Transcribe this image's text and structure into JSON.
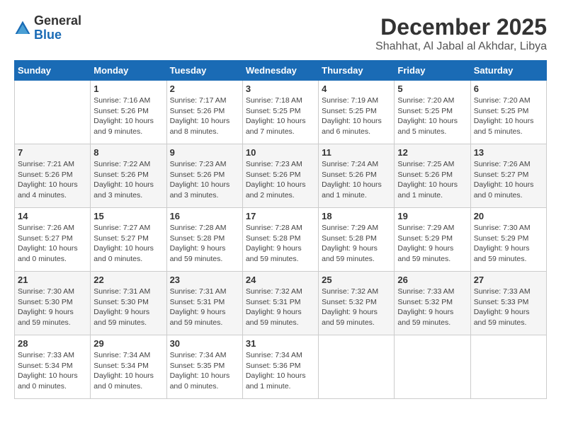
{
  "header": {
    "logo_general": "General",
    "logo_blue": "Blue",
    "month_year": "December 2025",
    "location": "Shahhat, Al Jabal al Akhdar, Libya"
  },
  "days_of_week": [
    "Sunday",
    "Monday",
    "Tuesday",
    "Wednesday",
    "Thursday",
    "Friday",
    "Saturday"
  ],
  "weeks": [
    [
      {
        "day": "",
        "content": ""
      },
      {
        "day": "1",
        "content": "Sunrise: 7:16 AM\nSunset: 5:26 PM\nDaylight: 10 hours and 9 minutes."
      },
      {
        "day": "2",
        "content": "Sunrise: 7:17 AM\nSunset: 5:26 PM\nDaylight: 10 hours and 8 minutes."
      },
      {
        "day": "3",
        "content": "Sunrise: 7:18 AM\nSunset: 5:25 PM\nDaylight: 10 hours and 7 minutes."
      },
      {
        "day": "4",
        "content": "Sunrise: 7:19 AM\nSunset: 5:25 PM\nDaylight: 10 hours and 6 minutes."
      },
      {
        "day": "5",
        "content": "Sunrise: 7:20 AM\nSunset: 5:25 PM\nDaylight: 10 hours and 5 minutes."
      },
      {
        "day": "6",
        "content": "Sunrise: 7:20 AM\nSunset: 5:25 PM\nDaylight: 10 hours and 5 minutes."
      }
    ],
    [
      {
        "day": "7",
        "content": "Sunrise: 7:21 AM\nSunset: 5:26 PM\nDaylight: 10 hours and 4 minutes."
      },
      {
        "day": "8",
        "content": "Sunrise: 7:22 AM\nSunset: 5:26 PM\nDaylight: 10 hours and 3 minutes."
      },
      {
        "day": "9",
        "content": "Sunrise: 7:23 AM\nSunset: 5:26 PM\nDaylight: 10 hours and 3 minutes."
      },
      {
        "day": "10",
        "content": "Sunrise: 7:23 AM\nSunset: 5:26 PM\nDaylight: 10 hours and 2 minutes."
      },
      {
        "day": "11",
        "content": "Sunrise: 7:24 AM\nSunset: 5:26 PM\nDaylight: 10 hours and 1 minute."
      },
      {
        "day": "12",
        "content": "Sunrise: 7:25 AM\nSunset: 5:26 PM\nDaylight: 10 hours and 1 minute."
      },
      {
        "day": "13",
        "content": "Sunrise: 7:26 AM\nSunset: 5:27 PM\nDaylight: 10 hours and 0 minutes."
      }
    ],
    [
      {
        "day": "14",
        "content": "Sunrise: 7:26 AM\nSunset: 5:27 PM\nDaylight: 10 hours and 0 minutes."
      },
      {
        "day": "15",
        "content": "Sunrise: 7:27 AM\nSunset: 5:27 PM\nDaylight: 10 hours and 0 minutes."
      },
      {
        "day": "16",
        "content": "Sunrise: 7:28 AM\nSunset: 5:28 PM\nDaylight: 9 hours and 59 minutes."
      },
      {
        "day": "17",
        "content": "Sunrise: 7:28 AM\nSunset: 5:28 PM\nDaylight: 9 hours and 59 minutes."
      },
      {
        "day": "18",
        "content": "Sunrise: 7:29 AM\nSunset: 5:28 PM\nDaylight: 9 hours and 59 minutes."
      },
      {
        "day": "19",
        "content": "Sunrise: 7:29 AM\nSunset: 5:29 PM\nDaylight: 9 hours and 59 minutes."
      },
      {
        "day": "20",
        "content": "Sunrise: 7:30 AM\nSunset: 5:29 PM\nDaylight: 9 hours and 59 minutes."
      }
    ],
    [
      {
        "day": "21",
        "content": "Sunrise: 7:30 AM\nSunset: 5:30 PM\nDaylight: 9 hours and 59 minutes."
      },
      {
        "day": "22",
        "content": "Sunrise: 7:31 AM\nSunset: 5:30 PM\nDaylight: 9 hours and 59 minutes."
      },
      {
        "day": "23",
        "content": "Sunrise: 7:31 AM\nSunset: 5:31 PM\nDaylight: 9 hours and 59 minutes."
      },
      {
        "day": "24",
        "content": "Sunrise: 7:32 AM\nSunset: 5:31 PM\nDaylight: 9 hours and 59 minutes."
      },
      {
        "day": "25",
        "content": "Sunrise: 7:32 AM\nSunset: 5:32 PM\nDaylight: 9 hours and 59 minutes."
      },
      {
        "day": "26",
        "content": "Sunrise: 7:33 AM\nSunset: 5:32 PM\nDaylight: 9 hours and 59 minutes."
      },
      {
        "day": "27",
        "content": "Sunrise: 7:33 AM\nSunset: 5:33 PM\nDaylight: 9 hours and 59 minutes."
      }
    ],
    [
      {
        "day": "28",
        "content": "Sunrise: 7:33 AM\nSunset: 5:34 PM\nDaylight: 10 hours and 0 minutes."
      },
      {
        "day": "29",
        "content": "Sunrise: 7:34 AM\nSunset: 5:34 PM\nDaylight: 10 hours and 0 minutes."
      },
      {
        "day": "30",
        "content": "Sunrise: 7:34 AM\nSunset: 5:35 PM\nDaylight: 10 hours and 0 minutes."
      },
      {
        "day": "31",
        "content": "Sunrise: 7:34 AM\nSunset: 5:36 PM\nDaylight: 10 hours and 1 minute."
      },
      {
        "day": "",
        "content": ""
      },
      {
        "day": "",
        "content": ""
      },
      {
        "day": "",
        "content": ""
      }
    ]
  ]
}
